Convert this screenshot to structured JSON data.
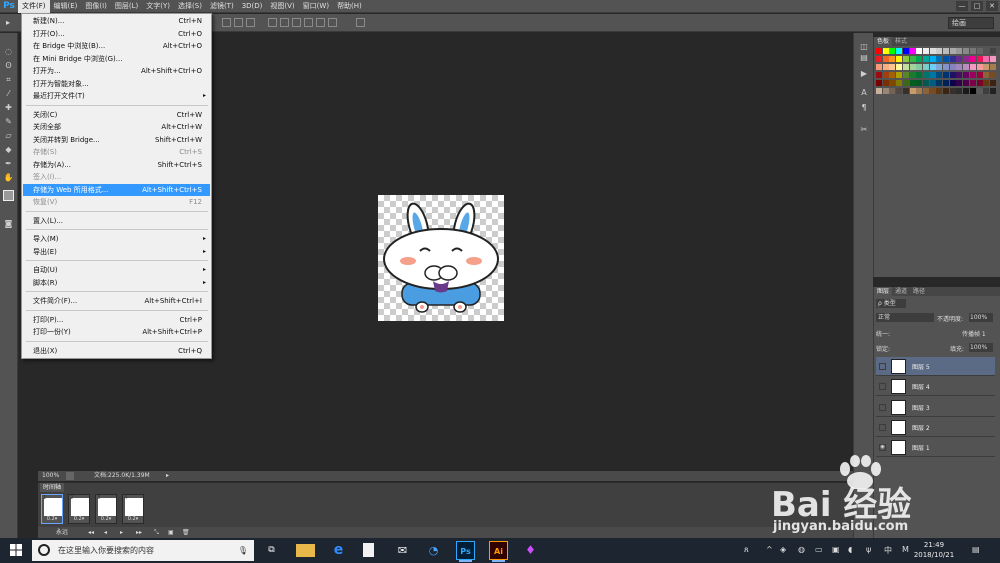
{
  "app": {
    "logo": "Ps",
    "menus": [
      "文件(F)",
      "编辑(E)",
      "图像(I)",
      "图层(L)",
      "文字(Y)",
      "选择(S)",
      "滤镜(T)",
      "3D(D)",
      "视图(V)",
      "窗口(W)",
      "帮助(H)"
    ],
    "window_controls": [
      "—",
      "□",
      "✕"
    ],
    "workspace": "绘画"
  },
  "file_menu": {
    "items": [
      {
        "label": "新建(N)...",
        "shortcut": "Ctrl+N",
        "state": "normal",
        "submenu": false
      },
      {
        "label": "打开(O)...",
        "shortcut": "Ctrl+O",
        "state": "normal",
        "submenu": false
      },
      {
        "label": "在 Bridge 中浏览(B)...",
        "shortcut": "Alt+Ctrl+O",
        "state": "normal",
        "submenu": false
      },
      {
        "label": "在 Mini Bridge 中浏览(G)...",
        "shortcut": "",
        "state": "normal",
        "submenu": false
      },
      {
        "label": "打开为...",
        "shortcut": "Alt+Shift+Ctrl+O",
        "state": "normal",
        "submenu": false
      },
      {
        "label": "打开为智能对象...",
        "shortcut": "",
        "state": "normal",
        "submenu": false
      },
      {
        "label": "最近打开文件(T)",
        "shortcut": "",
        "state": "normal",
        "submenu": true
      },
      {
        "label": "关闭(C)",
        "shortcut": "Ctrl+W",
        "state": "normal",
        "submenu": false
      },
      {
        "label": "关闭全部",
        "shortcut": "Alt+Ctrl+W",
        "state": "normal",
        "submenu": false
      },
      {
        "label": "关闭并转到 Bridge...",
        "shortcut": "Shift+Ctrl+W",
        "state": "normal",
        "submenu": false
      },
      {
        "label": "存储(S)",
        "shortcut": "Ctrl+S",
        "state": "disabled",
        "submenu": false
      },
      {
        "label": "存储为(A)...",
        "shortcut": "Shift+Ctrl+S",
        "state": "normal",
        "submenu": false
      },
      {
        "label": "签入(I)...",
        "shortcut": "",
        "state": "disabled",
        "submenu": false
      },
      {
        "label": "存储为 Web 所用格式...",
        "shortcut": "Alt+Shift+Ctrl+S",
        "state": "highlighted",
        "submenu": false
      },
      {
        "label": "恢复(V)",
        "shortcut": "F12",
        "state": "disabled",
        "submenu": false
      },
      {
        "label": "置入(L)...",
        "shortcut": "",
        "state": "normal",
        "submenu": false
      },
      {
        "label": "导入(M)",
        "shortcut": "",
        "state": "normal",
        "submenu": true
      },
      {
        "label": "导出(E)",
        "shortcut": "",
        "state": "normal",
        "submenu": true
      },
      {
        "label": "自动(U)",
        "shortcut": "",
        "state": "normal",
        "submenu": true
      },
      {
        "label": "脚本(R)",
        "shortcut": "",
        "state": "normal",
        "submenu": true
      },
      {
        "label": "文件简介(F)...",
        "shortcut": "Alt+Shift+Ctrl+I",
        "state": "normal",
        "submenu": false
      },
      {
        "label": "打印(P)...",
        "shortcut": "Ctrl+P",
        "state": "normal",
        "submenu": false
      },
      {
        "label": "打印一份(Y)",
        "shortcut": "Alt+Shift+Ctrl+P",
        "state": "normal",
        "submenu": false
      },
      {
        "label": "退出(X)",
        "shortcut": "Ctrl+Q",
        "state": "normal",
        "submenu": false
      }
    ]
  },
  "status": {
    "zoom": "100%",
    "doc": "文档:225.0K/1.39M"
  },
  "timeline": {
    "tab": "时间轴",
    "frames": [
      {
        "number": "1",
        "delay": "0.2▾"
      },
      {
        "number": "2",
        "delay": "0.2▾"
      },
      {
        "number": "3",
        "delay": "0.2▾"
      },
      {
        "number": "4",
        "delay": "0.2▾"
      }
    ],
    "loop": "永远"
  },
  "swatches": {
    "tabs": [
      "色板",
      "样式"
    ]
  },
  "layers": {
    "tabs": [
      "图层",
      "通道",
      "路径"
    ],
    "filter": "ρ 类型",
    "blend": "正常",
    "opacity_label": "不透明度:",
    "opacity": "100%",
    "unify_label": "统一:",
    "propagate": "传播帧 1",
    "lock_label": "锁定:",
    "fill_label": "填充:",
    "fill": "100%",
    "items": [
      {
        "name": "图层 5",
        "visible": false,
        "selected": true
      },
      {
        "name": "图层 4",
        "visible": false,
        "selected": false
      },
      {
        "name": "图层 3",
        "visible": false,
        "selected": false
      },
      {
        "name": "图层 2",
        "visible": false,
        "selected": false
      },
      {
        "name": "图层 1",
        "visible": true,
        "selected": false
      }
    ]
  },
  "taskbar": {
    "search_placeholder": "在这里输入你要搜索的内容",
    "apps": [
      "task-view",
      "file-explorer",
      "edge",
      "file",
      "mail",
      "network",
      "Ps",
      "Ai",
      "paint"
    ],
    "time": "21:49",
    "date": "2018/10/21",
    "ime": "M"
  },
  "watermark": {
    "brand": "Bai 经验",
    "url": "jingyan.baidu.com"
  },
  "colors": {
    "accent": "#3399ff",
    "ps_blue": "#31a8ff",
    "ai_orange": "#ff9a00",
    "selected_layer": "#5b6b86"
  }
}
